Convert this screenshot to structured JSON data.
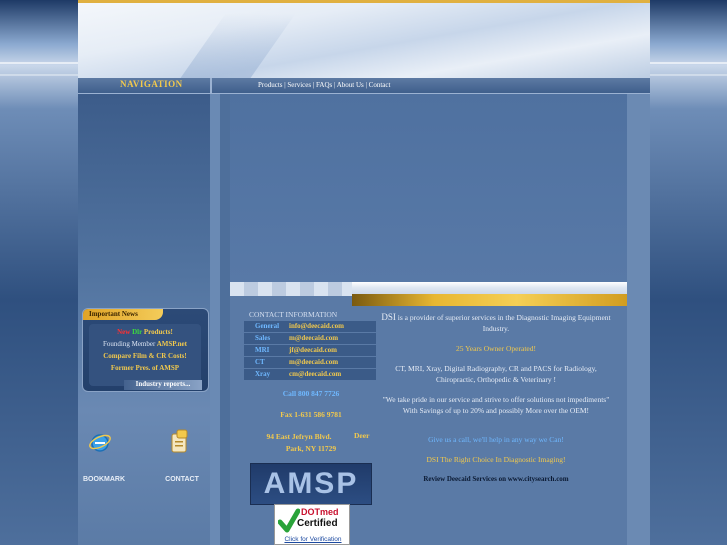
{
  "header": {
    "nav_title": "NAVIGATION",
    "links": "Products | Services | FAQs | About Us | Contact"
  },
  "sidebar": {
    "news_title": "Important News",
    "news_new": "New",
    "news_dlr": "Dlr",
    "news_products": "Products!",
    "news_founding_prefix": "Founding Member",
    "news_founding_link": "AMSP.net",
    "news_compare": "Compare Film & CR Costs!",
    "news_former": "Former Pres. of AMSP",
    "news_industry": "Industry reports...",
    "bookmark_label": "BOOKMARK",
    "contact_label": "CONTACT"
  },
  "contact": {
    "heading": "CONTACT INFORMATION",
    "rows": [
      {
        "key": "General",
        "value": "info@deecaid.com"
      },
      {
        "key": "Sales",
        "value": "m@deecaid.com"
      },
      {
        "key": "MRI",
        "value": "jf@deecaid.com"
      },
      {
        "key": "CT",
        "value": "m@deecaid.com"
      },
      {
        "key": "Xray",
        "value": "cm@deecaid.com"
      }
    ],
    "call": "Call 800 847 7726",
    "fax": "Fax  1-631 586 9781",
    "address_line1": "94 East Jefryn Blvd.",
    "address_deer": "Deer",
    "address_line2": "Park, NY 11729",
    "amsp_logo": "AMSP",
    "dotmed_brand": "DOTmed",
    "dotmed_certified": "Certified",
    "dotmed_verify": "Click for Verification"
  },
  "main": {
    "intro_dsi": "DSI",
    "intro_rest": " is a provider of  superior services in the Diagnostic Imaging Equipment Industry.",
    "years": "25 Years Owner Operated!",
    "services": "CT, MRI, Xray, Digital Radiography, CR and PACS for Radiology, Chiropractic, Orthopedic & Veterinary !",
    "quote": "\"We take pride in our service and strive to offer solutions not impediments\"   With Savings of up to 20% and possibly More over the OEM!",
    "call_cta": "Give us a call, we'll help in any way we Can!",
    "tagline": "DSI     The Right Choice In Diagnostic Imaging!",
    "review": "Review Deecaid Services on www.citysearch.com"
  }
}
